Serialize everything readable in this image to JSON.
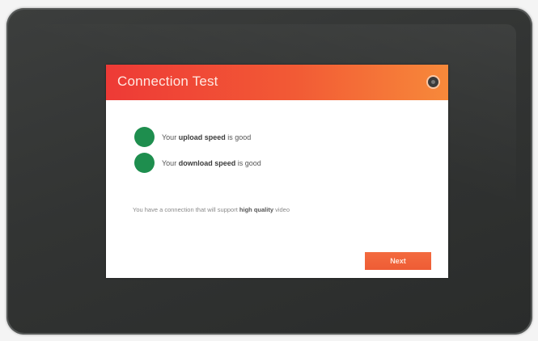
{
  "dialog": {
    "title": "Connection Test",
    "next_label": "Next"
  },
  "results": [
    {
      "prefix": "Your",
      "label": "upload speed",
      "suffix": "is good"
    },
    {
      "prefix": "Your",
      "label": "download speed",
      "suffix": "is good"
    }
  ],
  "note": {
    "text": "You have a connection that will support",
    "emphasis": "high quality",
    "suffix": "video"
  },
  "colors": {
    "header_start": "#ee3a36",
    "header_end": "#f7893a",
    "status_good": "#1e8e4e",
    "button": "#f06238",
    "bezel": "#333534"
  },
  "icons": {
    "close": "close-icon",
    "status": "status-good-icon"
  }
}
